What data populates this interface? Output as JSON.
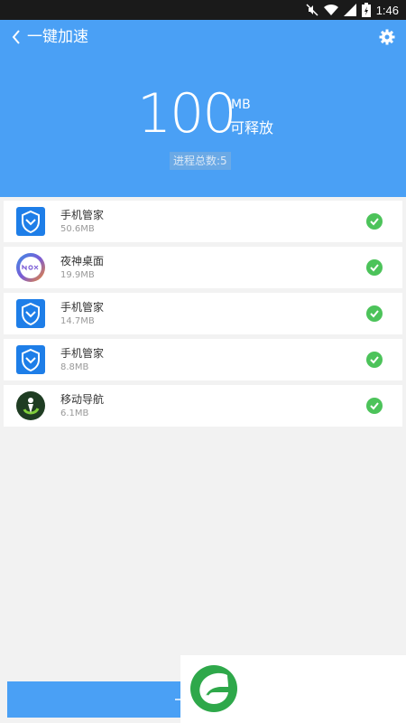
{
  "status_bar": {
    "time": "1:46"
  },
  "header": {
    "title": "一键加速",
    "amount": "100",
    "unit": "MB",
    "unit_label": "可释放",
    "process_count": "进程总数:5"
  },
  "apps": [
    {
      "name": "手机管家",
      "size": "50.6MB",
      "icon": "shield-icon"
    },
    {
      "name": "夜神桌面",
      "size": "19.9MB",
      "icon": "nox-icon"
    },
    {
      "name": "手机管家",
      "size": "14.7MB",
      "icon": "shield-icon"
    },
    {
      "name": "手机管家",
      "size": "8.8MB",
      "icon": "shield-icon"
    },
    {
      "name": "移动导航",
      "size": "6.1MB",
      "icon": "navigation-icon"
    }
  ],
  "colors": {
    "primary": "#4aa0f5",
    "check": "#4cc35a",
    "background": "#f2f2f2"
  }
}
